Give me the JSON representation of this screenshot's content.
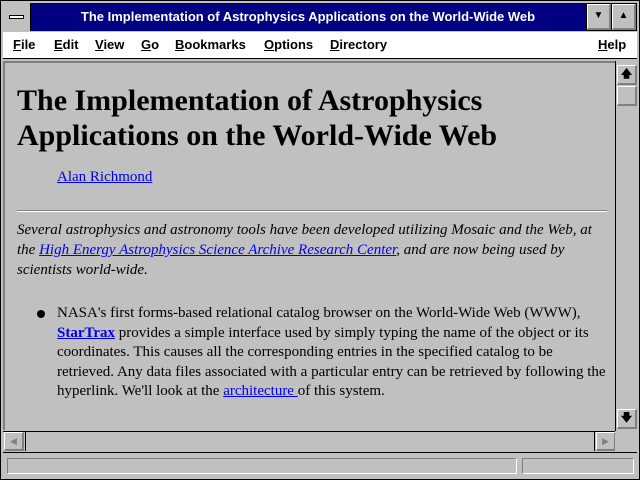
{
  "window": {
    "title": "The Implementation of Astrophysics Applications on the World-Wide Web",
    "minimize_glyph": "▼",
    "maximize_glyph": "▲"
  },
  "menubar": {
    "items": [
      {
        "label": "File"
      },
      {
        "label": "Edit"
      },
      {
        "label": "View"
      },
      {
        "label": "Go"
      },
      {
        "label": "Bookmarks"
      },
      {
        "label": "Options"
      },
      {
        "label": "Directory"
      },
      {
        "label": "Help"
      }
    ]
  },
  "document": {
    "heading_line1": "The Implementation of Astrophysics",
    "heading_line2": "Applications on the World-Wide Web",
    "author": "Alan Richmond",
    "abstract": {
      "before_link": "Several astrophysics and astronomy tools have been developed utilizing Mosaic and the Web, at the ",
      "link_text": "High Energy Astrophysics Science Archive Research Center",
      "after_link": ", and are now being used by scientists world-wide."
    },
    "bullet1": {
      "part1": "NASA's first forms-based relational catalog browser on the World-Wide Web (WWW),",
      "link1": "StarTrax",
      "part2": " provides a simple interface used by simply typing the name of the object or its coordinates. This causes all the corresponding entries in the specified catalog to be retrieved. Any data files associated with a particular entry can be retrieved by following the hyperlink. We'll look at the ",
      "link2": "architecture ",
      "part3": "of this system."
    }
  },
  "scrollbar": {
    "up_glyph": "🡅",
    "down_glyph": "🡇",
    "left_glyph": "◀",
    "right_glyph": "▶"
  },
  "colors": {
    "titlebar": "#000080",
    "link": "#0000ee",
    "chrome": "#c0c0c0"
  }
}
